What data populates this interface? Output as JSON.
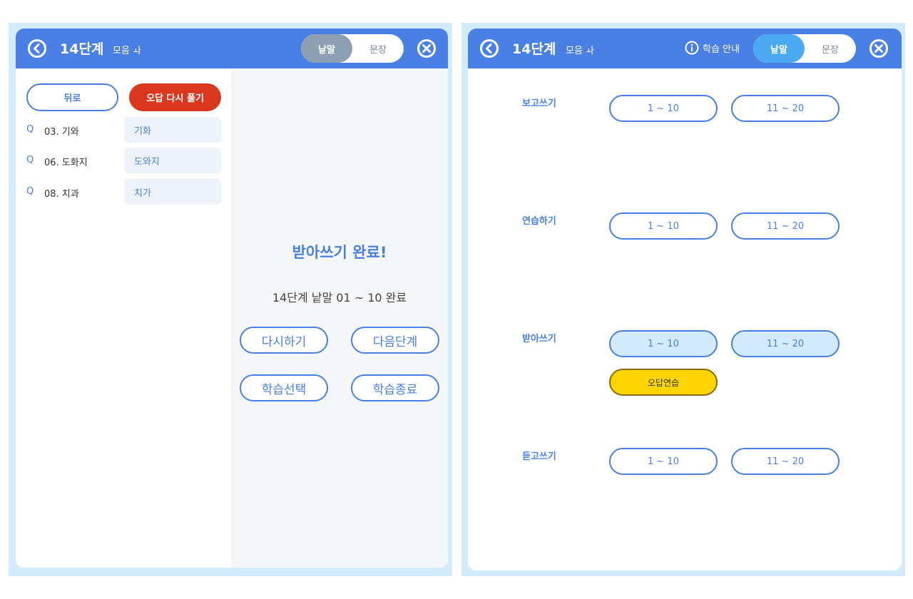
{
  "left": {
    "header": {
      "title": "14단계",
      "subtitle": "모음 ㅘ",
      "toggle_on": "낱말",
      "toggle_off": "문장"
    },
    "back_button": "뒤로",
    "retry_wrong_button": "오답 다시 풀기",
    "wrong_answers": [
      {
        "q": "Q",
        "question": "03. 기와",
        "answer": "기화"
      },
      {
        "q": "Q",
        "question": "06. 도화지",
        "answer": "도와지"
      },
      {
        "q": "Q",
        "question": "08. 치과",
        "answer": "치가"
      }
    ],
    "completion": {
      "title": "받아쓰기 완료!",
      "message": "14단계 낱말 01 ~ 10 완료",
      "buttons": {
        "retry": "다시하기",
        "next_level": "다음단계",
        "select_study": "학습선택",
        "end_study": "학습종료"
      }
    }
  },
  "right": {
    "header": {
      "title": "14단계",
      "subtitle": "모음 ㅘ",
      "guide": "학습 안내",
      "toggle_on": "낱말",
      "toggle_off": "문장"
    },
    "sections": [
      {
        "label": "보고쓰기",
        "ranges": [
          "1 ~ 10",
          "11 ~ 20"
        ]
      },
      {
        "label": "연습하기",
        "ranges": [
          "1 ~ 10",
          "11 ~ 20"
        ]
      },
      {
        "label": "받아쓰기",
        "ranges": [
          "1 ~ 10",
          "11 ~ 20"
        ],
        "review": "오답연습"
      },
      {
        "label": "듣고쓰기",
        "ranges": [
          "1 ~ 10",
          "11 ~ 20"
        ]
      }
    ]
  },
  "colors": {
    "header_blue": "#4a80e6",
    "panel_bg": "#d3ebfb",
    "red_button": "#d9381e",
    "yellow_button": "#fdd500",
    "active_range": "#d3eaff"
  }
}
